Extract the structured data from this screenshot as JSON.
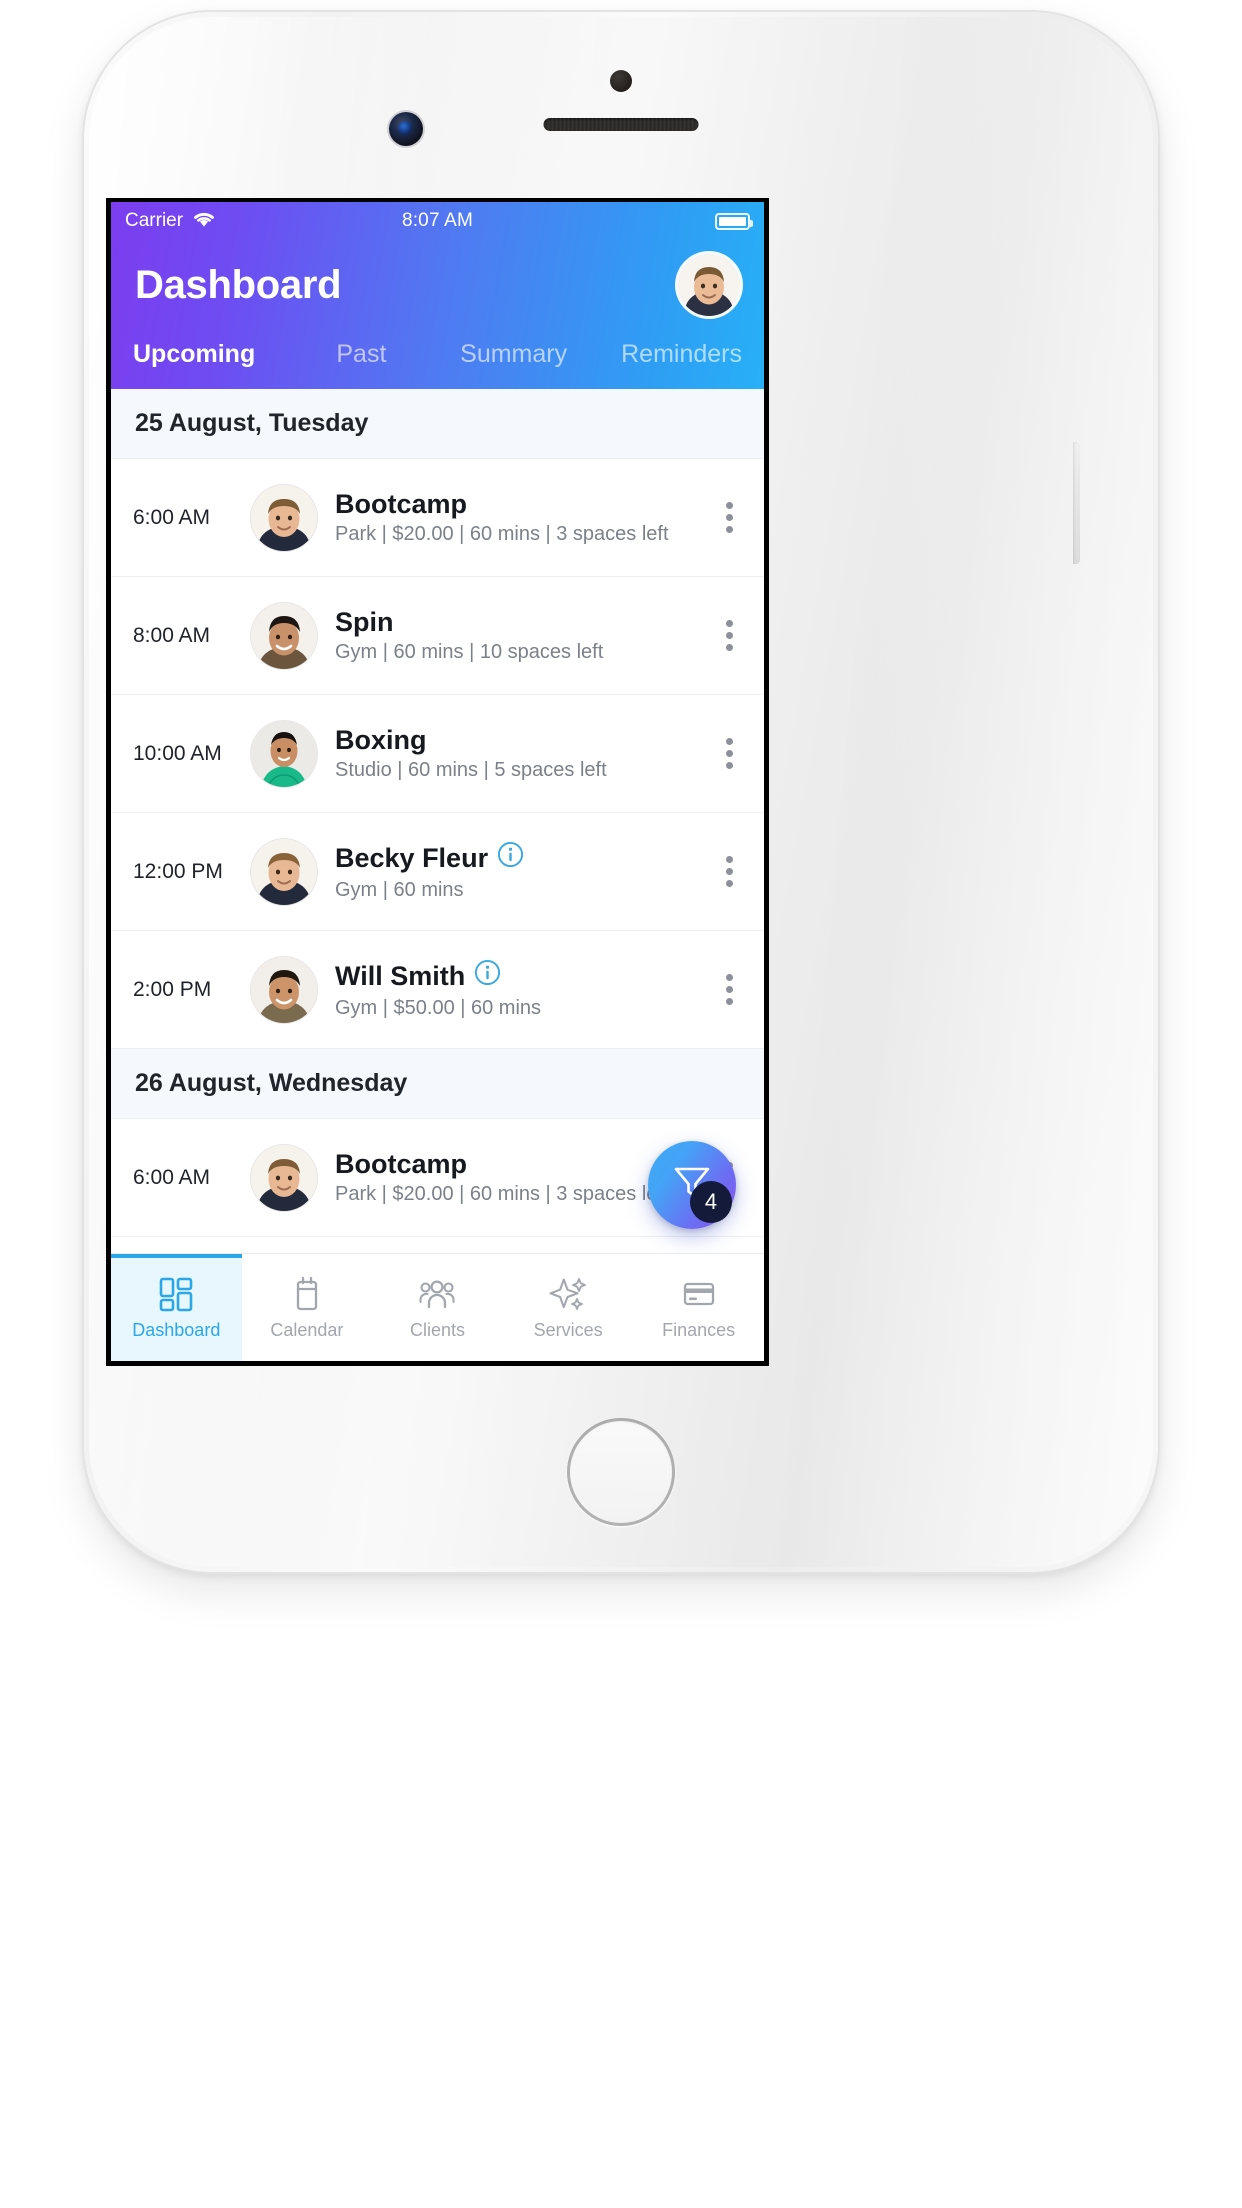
{
  "status_bar": {
    "carrier": "Carrier",
    "time": "8:07 AM",
    "wifi_icon": "wifi-icon",
    "battery_icon": "battery-full-icon"
  },
  "header": {
    "title": "Dashboard",
    "avatar": "user-avatar",
    "tabs": [
      {
        "label": "Upcoming",
        "active": true
      },
      {
        "label": "Past",
        "active": false
      },
      {
        "label": "Summary",
        "active": false
      },
      {
        "label": "Reminders",
        "active": false
      }
    ]
  },
  "sections": [
    {
      "date": "25 August, Tuesday",
      "rows": [
        {
          "time": "6:00 AM",
          "title": "Bootcamp",
          "has_info": false,
          "details": "Park | $20.00 | 60 mins | 3 spaces left"
        },
        {
          "time": "8:00 AM",
          "title": "Spin",
          "has_info": false,
          "details": "Gym | 60 mins | 10 spaces left"
        },
        {
          "time": "10:00 AM",
          "title": "Boxing",
          "has_info": false,
          "details": "Studio | 60 mins | 5 spaces left"
        },
        {
          "time": "12:00 PM",
          "title": "Becky Fleur",
          "has_info": true,
          "details": "Gym | 60 mins"
        },
        {
          "time": "2:00 PM",
          "title": "Will Smith",
          "has_info": true,
          "details": "Gym | $50.00 | 60 mins"
        }
      ]
    },
    {
      "date": "26 August, Wednesday",
      "rows": [
        {
          "time": "6:00 AM",
          "title": "Bootcamp",
          "has_info": false,
          "details": "Park | $20.00 | 60 mins | 3 spaces left"
        }
      ]
    }
  ],
  "fab": {
    "icon": "filter-funnel-icon",
    "badge": "4"
  },
  "bottom_nav": [
    {
      "label": "Dashboard",
      "icon": "dashboard-grid-icon",
      "active": true
    },
    {
      "label": "Calendar",
      "icon": "calendar-icon",
      "active": false
    },
    {
      "label": "Clients",
      "icon": "people-group-icon",
      "active": false
    },
    {
      "label": "Services",
      "icon": "sparkles-icon",
      "active": false
    },
    {
      "label": "Finances",
      "icon": "credit-card-icon",
      "active": false
    }
  ],
  "colors": {
    "gradient_start": "#7c3df0",
    "gradient_end": "#27b0f7",
    "accent": "#2ba7e8",
    "date_header_bg": "#f5f8fd",
    "badge_bg": "#141a3a",
    "info_icon": "#37a8e0",
    "muted_text": "#7b8189"
  }
}
